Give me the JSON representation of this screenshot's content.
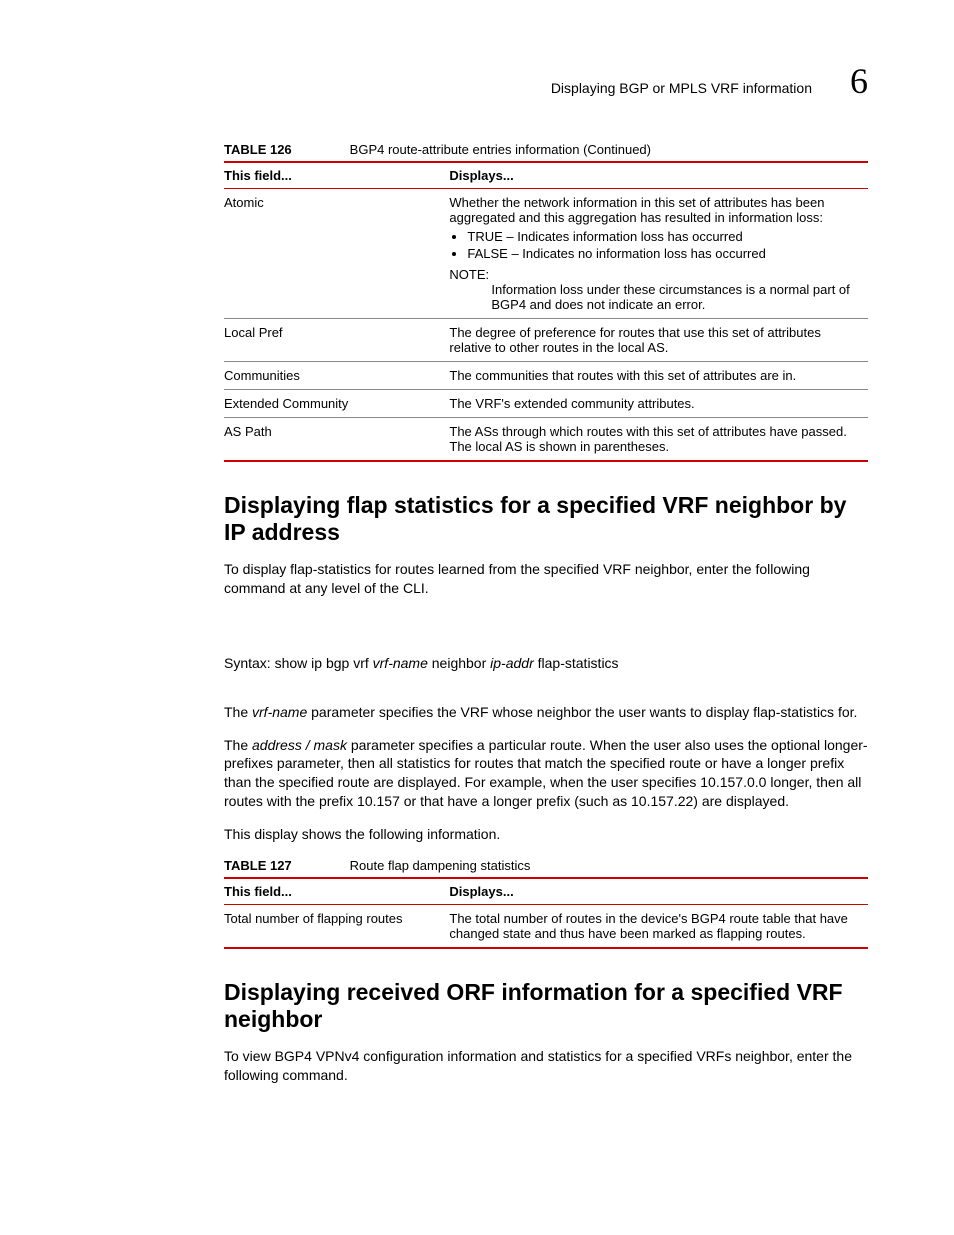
{
  "header": {
    "running": "Displaying BGP or MPLS VRF information",
    "chapter": "6"
  },
  "table126": {
    "label": "TABLE 126",
    "caption": "BGP4 route-attribute entries information  (Continued)",
    "head": {
      "c1": "This field...",
      "c2": "Displays..."
    },
    "rows": {
      "atomic": {
        "name": "Atomic",
        "intro": "Whether the network information in this set of attributes has been aggregated and this aggregation has resulted in information loss:",
        "b1": "TRUE – Indicates information loss has occurred",
        "b2": "FALSE – Indicates no information loss has occurred",
        "note_label": "NOTE:",
        "note": "Information loss under these circumstances is a normal part of BGP4 and does not indicate an error."
      },
      "localpref": {
        "name": "Local Pref",
        "desc": "The degree of preference for routes that use this set of attributes relative to other routes in the local AS."
      },
      "communities": {
        "name": "Communities",
        "desc": "The communities that routes with this set of attributes are in."
      },
      "extcomm": {
        "name": "Extended Community",
        "desc": "The VRF's extended community attributes."
      },
      "aspath": {
        "name": "AS Path",
        "desc": "The ASs through which routes with this set of attributes have passed. The local AS is shown in parentheses."
      }
    }
  },
  "sec1": {
    "heading": "Displaying flap statistics for a specified VRF neighbor by IP address",
    "p1": "To display flap-statistics for routes learned from the specified VRF neighbor, enter the following command at any level of the CLI.",
    "syntax": {
      "lbl": "Syntax:",
      "t1": " show ip bgp vrf ",
      "i1": "vrf-name",
      "t2": " neighbor ",
      "i2": "ip-addr",
      "t3": " flap-statistics"
    },
    "p2a": "The ",
    "p2i": "vrf-name",
    "p2b": " parameter specifies the VRF whose neighbor the user wants to display flap-statistics for.",
    "p3a": "The ",
    "p3i": "address / mask",
    "p3b": " parameter specifies a particular route. When the user also uses the optional longer-prefixes parameter, then all statistics for routes that match the specified route or have a longer prefix than the specified route are displayed. For example, when the user specifies 10.157.0.0 longer, then all routes with the prefix 10.157 or that have a longer prefix (such as 10.157.22) are displayed.",
    "p4": "This display shows the following information."
  },
  "table127": {
    "label": "TABLE 127",
    "caption": "Route flap dampening statistics",
    "head": {
      "c1": "This field...",
      "c2": "Displays..."
    },
    "row": {
      "name": "Total number of flapping routes",
      "desc": "The total number of routes in the device's BGP4 route table that have changed state and thus have been marked as flapping routes."
    }
  },
  "sec2": {
    "heading": "Displaying received ORF information for a specified VRF neighbor",
    "p1": "To view BGP4 VPNv4 configuration information and statistics for a specified VRFs neighbor, enter the following command."
  }
}
